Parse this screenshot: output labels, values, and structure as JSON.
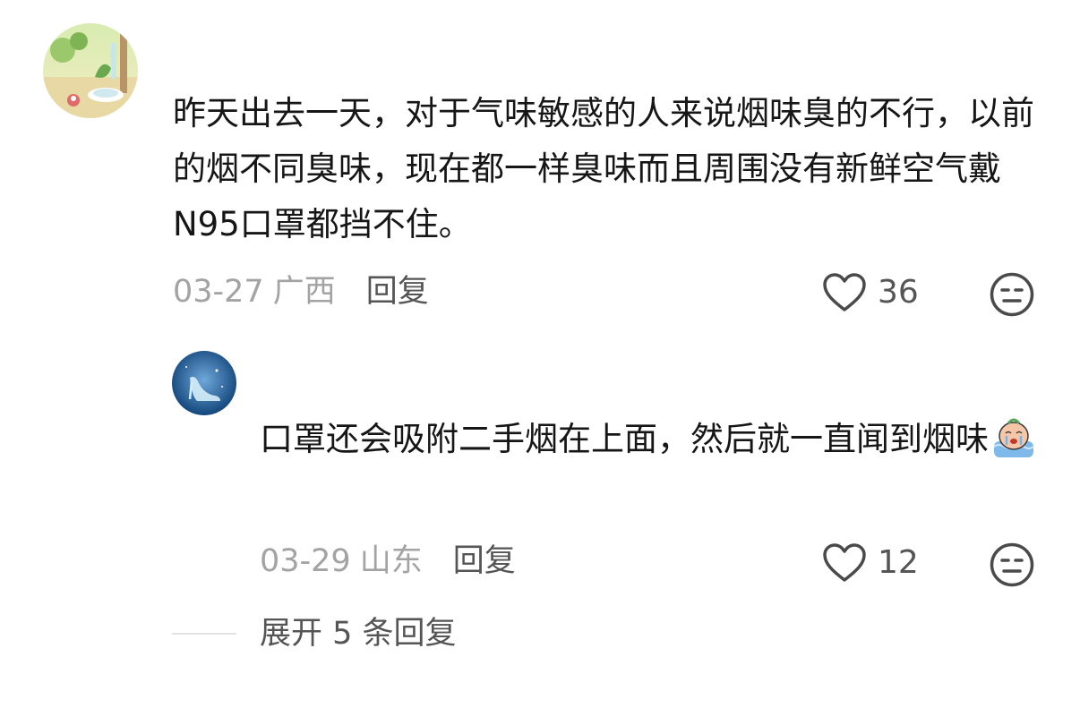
{
  "comment": {
    "text": "昨天出去一天，对于气味敏感的人来说烟味臭的不行，以前的烟不同臭味，现在都一样臭味而且周围没有新鲜空气戴N95口罩都挡不住。",
    "date": "03-27",
    "location": "广西",
    "reply_label": "回复",
    "like_count": "36",
    "avatar_icon": "landscape-avatar-icon",
    "like_icon": "heart-outline-icon",
    "dislike_icon": "unhappy-face-icon"
  },
  "reply": {
    "text": "口罩还会吸附二手烟在上面，然后就一直闻到烟味",
    "emoji": "crying-emoji",
    "date": "03-29",
    "location": "山东",
    "reply_label": "回复",
    "like_count": "12",
    "avatar_icon": "glass-slipper-avatar-icon",
    "like_icon": "heart-outline-icon",
    "dislike_icon": "unhappy-face-icon"
  },
  "expand": {
    "label": "展开 5 条回复"
  },
  "colors": {
    "text": "#161616",
    "meta": "#a3a3a3",
    "action": "#555555",
    "divider": "#e2e2e2"
  }
}
